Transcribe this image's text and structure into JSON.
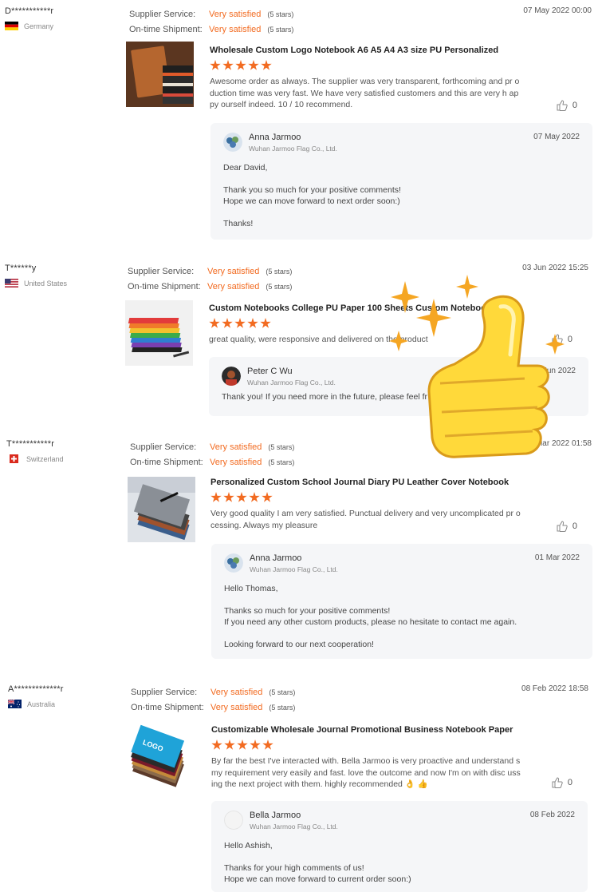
{
  "labels": {
    "supplier_service": "Supplier Service:",
    "ontime_shipment": "On-time Shipment:"
  },
  "colors": {
    "accent": "#f26b21",
    "reply_bg": "#f5f6f8"
  },
  "reviews": [
    {
      "buyer": "D***********r",
      "country": "Germany",
      "flag": "germany-flag",
      "supplier_value": "Very satisfied",
      "supplier_stars": "(5 stars)",
      "shipment_value": "Very satisfied",
      "shipment_stars": "(5 stars)",
      "date": "07 May 2022 00:00",
      "product_title": "Wholesale Custom Logo Notebook A6 A5 A4 A3 size PU Personalized",
      "rating": 5,
      "text": "Awesome order as always. The supplier was very transparent, forthcoming and pr oduction time was very fast. We have very satisfied customers and this are very h appy ourself indeed. 10 / 10 recommend.",
      "likes": "0",
      "reply": {
        "name": "Anna Jarmoo",
        "company": "Wuhan Jarmoo Flag Co., Ltd.",
        "date": "07 May 2022",
        "lines": [
          "Dear David,",
          "",
          "Thank you so much for your positive comments!",
          "Hope we can move forward to next  order soon:)",
          "",
          "Thanks!"
        ]
      }
    },
    {
      "buyer": "T******y",
      "country": "United States",
      "flag": "usa-flag",
      "supplier_value": "Very satisfied",
      "supplier_stars": "(5 stars)",
      "shipment_value": "Very satisfied",
      "shipment_stars": "(5 stars)",
      "date": "03 Jun 2022 15:25",
      "product_title": "Custom Notebooks College PU Paper 100 Sheets Custom Notebook",
      "rating": 5,
      "text": "great quality, were responsive and delivered on the product",
      "likes": "0",
      "reply": {
        "name": "Peter C Wu",
        "company": "Wuhan Jarmoo Flag Co., Ltd.",
        "date": "05 Jun 2022",
        "lines": [
          "Thank you! If you need more in the future, please feel fr"
        ]
      }
    },
    {
      "buyer": "T***********r",
      "country": "Switzerland",
      "flag": "switzerland-flag",
      "supplier_value": "Very satisfied",
      "supplier_stars": "(5 stars)",
      "shipment_value": "Very satisfied",
      "shipment_stars": "(5 stars)",
      "date": "01 Mar 2022 01:58",
      "product_title": "Personalized Custom School Journal Diary PU Leather Cover Notebook",
      "rating": 5,
      "text": "Very good quality I am very satisfied. Punctual delivery and very uncomplicated pr ocessing. Always my pleasure",
      "likes": "0",
      "reply": {
        "name": "Anna Jarmoo",
        "company": "Wuhan Jarmoo Flag Co., Ltd.",
        "date": "01 Mar 2022",
        "lines": [
          "Hello Thomas,",
          "",
          "Thanks so much for your positive comments!",
          "If you need any other custom products, please no hesitate to contact me again.",
          "",
          "Looking forward to our next cooperation!"
        ]
      }
    },
    {
      "buyer": "A*************r",
      "country": "Australia",
      "flag": "australia-flag",
      "supplier_value": "Very satisfied",
      "supplier_stars": "(5 stars)",
      "shipment_value": "Very satisfied",
      "shipment_stars": "(5 stars)",
      "date": "08 Feb 2022 18:58",
      "product_title": "Customizable Wholesale Journal Promotional Business Notebook Paper",
      "rating": 5,
      "text": "By far the best I've interacted with. Bella Jarmoo is very proactive and understand s my requirement very easily and fast. love the outcome and now I'm on with disc ussing the next project with them. highly recommended 👌 👍",
      "likes": "0",
      "reply": {
        "name": "Bella Jarmoo",
        "company": "Wuhan Jarmoo Flag Co., Ltd.",
        "date": "08 Feb 2022",
        "lines": [
          "Hello Ashish,",
          "",
          "Thanks for your high comments of us!",
          "Hope we can move forward to current order soon:)"
        ]
      }
    }
  ],
  "thumb_logo_text": "LOGO",
  "sticker_icon": "thumbs-up-sticker"
}
